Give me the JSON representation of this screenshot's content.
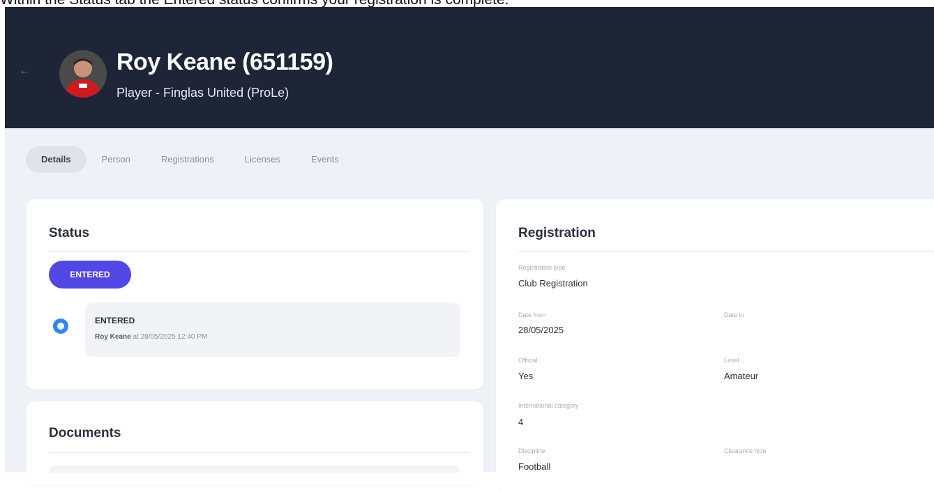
{
  "caption": "Within the Status tab the Entered status confirms your registration is complete.",
  "header": {
    "title": "Roy Keane (651159)",
    "subtitle": "Player - Finglas United (ProLe)"
  },
  "tabs": [
    {
      "label": "Details",
      "active": true
    },
    {
      "label": "Person"
    },
    {
      "label": "Registrations"
    },
    {
      "label": "Licenses"
    },
    {
      "label": "Events"
    }
  ],
  "status_card": {
    "title": "Status",
    "badge": "ENTERED",
    "event": {
      "title": "ENTERED",
      "user": "Roy Keane",
      "meta": "at 28/05/2025 12:40 PM"
    }
  },
  "documents_card": {
    "title": "Documents"
  },
  "registration_card": {
    "title": "Registration",
    "fields": {
      "registration_type": {
        "label": "Registration type",
        "value": "Club Registration"
      },
      "date_from": {
        "label": "Date from",
        "value": "28/05/2025"
      },
      "date_to": {
        "label": "Date to",
        "value": ""
      },
      "official": {
        "label": "Official",
        "value": "Yes"
      },
      "level": {
        "label": "Level",
        "value": "Amateur"
      },
      "international_category": {
        "label": "International category",
        "value": "4"
      },
      "discipline": {
        "label": "Discipline",
        "value": "Football"
      },
      "clearance_type": {
        "label": "Clearance type",
        "value": ""
      }
    }
  },
  "colors": {
    "header_bg": "#1d2537",
    "content_bg": "#eef1f6",
    "accent": "#5147e6",
    "radio": "#2f86f5"
  }
}
